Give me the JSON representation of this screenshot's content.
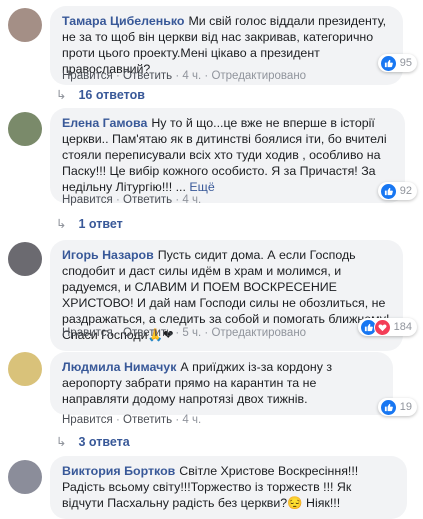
{
  "actions": {
    "like": "Нравится",
    "reply": "Ответить",
    "edited": "Отредактировано",
    "sep": "·"
  },
  "comments": [
    {
      "author": "Тамара Цибеленько",
      "text": "Ми свій голос віддали президенту, не за то щоб він церкви від нас закривав, категорично проти цього проекту.Мені цікаво а президент православний?",
      "time": "4 ч.",
      "edited": true,
      "reactions": [
        "like"
      ],
      "reaction_count": "95",
      "replies": "16 ответов"
    },
    {
      "author": "Елена Гамова",
      "text": "Ну то й що...це вже не вперше в історії церкви.. Пам'ятаю як в дитинстві боялися іти, бо вчителі стояли переписували всіх хто туди ходив , особливо на Паску!!! Це вибір кожного особисто. Я за Причастя! За недільну Літургію!!! ...",
      "more": "Ещё",
      "time": "4 ч.",
      "edited": false,
      "reactions": [
        "like"
      ],
      "reaction_count": "92",
      "replies": "1 ответ"
    },
    {
      "author": "Игорь Назаров",
      "text": "Пусть сидит дома. А если Господь сподобит и даст силы идём в храм и молимся, и радуемся, и СЛАВИМ И ПОЕМ ВОСКРЕСЕНИЕ ХРИСТОВО! И дай нам Господи силы не обозлиться, не раздражаться, а следить за собой и помогать ближнему! Спаси Господи🙏❤",
      "time": "5 ч.",
      "edited": true,
      "reactions": [
        "like",
        "love"
      ],
      "reaction_count": "184",
      "replies": ""
    },
    {
      "author": "Людмила Нимачук",
      "text": "А приїджих із-за кордону з аеропорту забрати прямо на карантин та не направляти додому напротязі двох тижнів.",
      "time": "4 ч.",
      "edited": false,
      "reactions": [
        "like"
      ],
      "reaction_count": "19",
      "replies": "3 ответа"
    },
    {
      "author": "Виктория Бортков",
      "text": "Світле Христове Воскресіння!!! Радість всьому світу!!!Торжество із торжеств !!! Як відчути Пасхальну радість без церкви?😔 Ніяк!!!",
      "time": "",
      "edited": false,
      "reactions": [],
      "reaction_count": "",
      "replies": ""
    }
  ]
}
